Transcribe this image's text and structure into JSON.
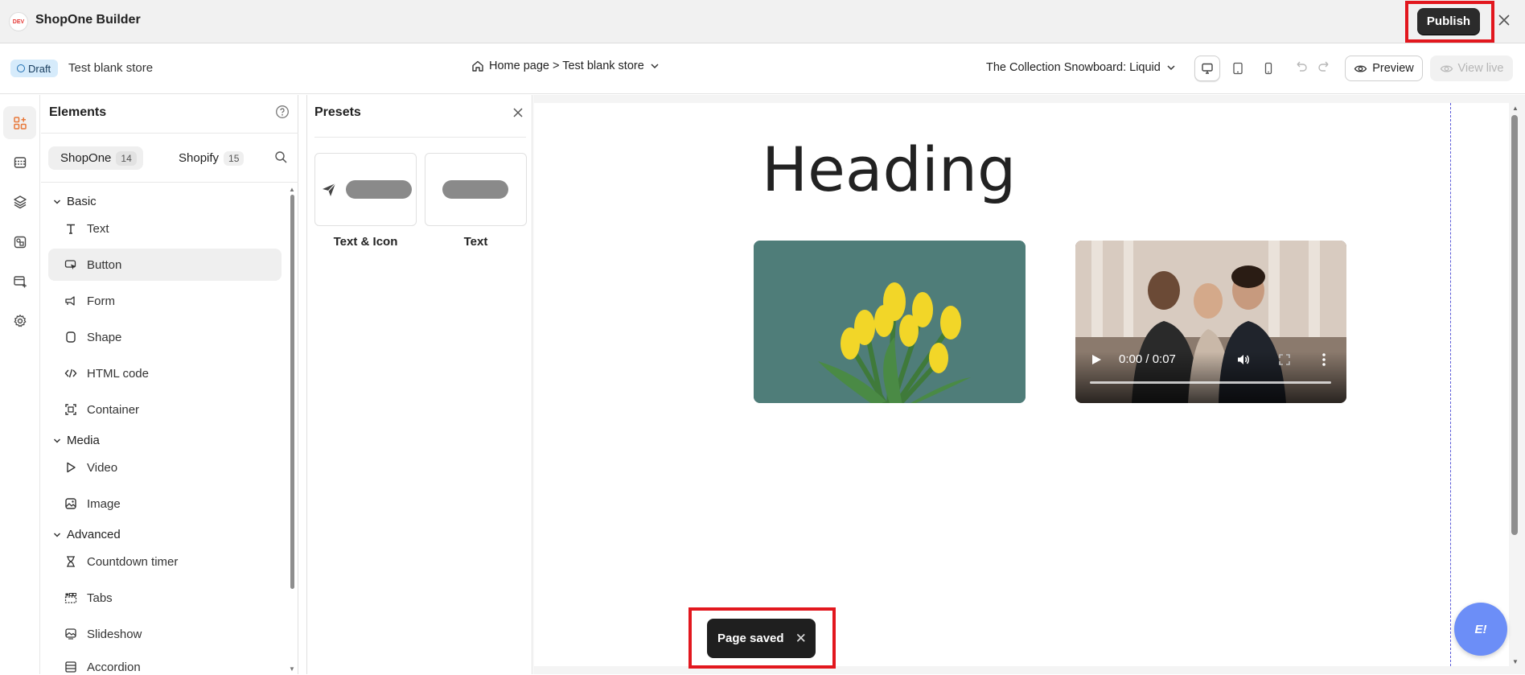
{
  "app": {
    "logo_text": "DEV",
    "title": "ShopOne Builder"
  },
  "toolbar": {
    "publish_label": "Publish"
  },
  "subbar": {
    "status_badge": "Draft",
    "store_name": "Test blank store",
    "breadcrumb": "Home page > Test blank store",
    "template": "The Collection Snowboard: Liquid",
    "preview_label": "Preview",
    "view_live_label": "View live"
  },
  "elements_panel": {
    "title": "Elements",
    "tabs": [
      {
        "label": "ShopOne",
        "count": "14"
      },
      {
        "label": "Shopify",
        "count": "15"
      }
    ],
    "sections": [
      {
        "label": "Basic"
      },
      {
        "label": "Media"
      },
      {
        "label": "Advanced"
      }
    ],
    "items": [
      {
        "label": "Text",
        "icon": "text-icon"
      },
      {
        "label": "Button",
        "icon": "button-cursor-icon"
      },
      {
        "label": "Form",
        "icon": "form-icon"
      },
      {
        "label": "Shape",
        "icon": "shape-icon"
      },
      {
        "label": "HTML code",
        "icon": "code-icon"
      },
      {
        "label": "Container",
        "icon": "container-icon"
      },
      {
        "label": "Video",
        "icon": "play-icon"
      },
      {
        "label": "Image",
        "icon": "image-icon"
      },
      {
        "label": "Countdown timer",
        "icon": "hourglass-icon"
      },
      {
        "label": "Tabs",
        "icon": "tabs-icon"
      },
      {
        "label": "Slideshow",
        "icon": "slideshow-icon"
      },
      {
        "label": "Accordion",
        "icon": "accordion-icon"
      }
    ]
  },
  "presets_panel": {
    "title": "Presets",
    "cards": [
      {
        "label": "Text & Icon"
      },
      {
        "label": "Text"
      }
    ]
  },
  "canvas": {
    "heading": "Heading",
    "video_time": "0:00 / 0:07"
  },
  "toast": {
    "message": "Page saved"
  },
  "chat": {
    "label": "E!"
  },
  "colors": {
    "accent_orange": "#e8793a",
    "highlight_red": "#e2171e",
    "publish_bg": "#2b2b2b",
    "draft_badge_bg": "#d6ebfb",
    "chat_bubble": "#6c8ef7"
  }
}
